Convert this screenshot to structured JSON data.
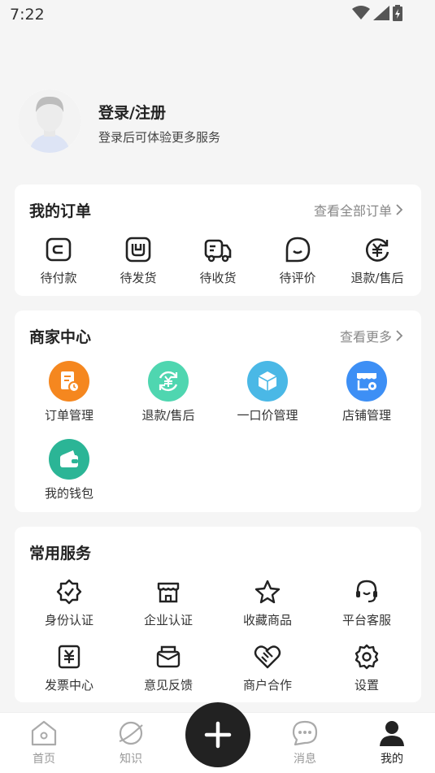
{
  "status_bar": {
    "time": "7:22"
  },
  "profile": {
    "title": "登录/注册",
    "subtitle": "登录后可体验更多服务"
  },
  "orders": {
    "title": "我的订单",
    "more": "查看全部订单",
    "items": [
      {
        "label": "待付款",
        "icon": "wallet-card-icon"
      },
      {
        "label": "待发货",
        "icon": "package-icon"
      },
      {
        "label": "待收货",
        "icon": "truck-icon"
      },
      {
        "label": "待评价",
        "icon": "comment-icon"
      },
      {
        "label": "退款/售后",
        "icon": "refund-icon"
      }
    ]
  },
  "merchant": {
    "title": "商家中心",
    "more": "查看更多",
    "items": [
      {
        "label": "订单管理",
        "icon": "order-manage-icon",
        "color": "#f5871f"
      },
      {
        "label": "退款/售后",
        "icon": "refund-cycle-icon",
        "color": "#4fd6b0"
      },
      {
        "label": "一口价管理",
        "icon": "box-icon",
        "color": "#4ab8e6"
      },
      {
        "label": "店铺管理",
        "icon": "store-settings-icon",
        "color": "#3d8ff5"
      },
      {
        "label": "我的钱包",
        "icon": "wallet-icon",
        "color": "#2bb596"
      }
    ]
  },
  "services": {
    "title": "常用服务",
    "items": [
      {
        "label": "身份认证",
        "icon": "badge-check-icon"
      },
      {
        "label": "企业认证",
        "icon": "shop-icon"
      },
      {
        "label": "收藏商品",
        "icon": "star-icon"
      },
      {
        "label": "平台客服",
        "icon": "headset-icon"
      },
      {
        "label": "发票中心",
        "icon": "invoice-icon"
      },
      {
        "label": "意见反馈",
        "icon": "feedback-icon"
      },
      {
        "label": "商户合作",
        "icon": "handshake-icon"
      },
      {
        "label": "设置",
        "icon": "gear-icon"
      }
    ]
  },
  "tabbar": {
    "home": "首页",
    "knowledge": "知识",
    "messages": "消息",
    "mine": "我的"
  }
}
